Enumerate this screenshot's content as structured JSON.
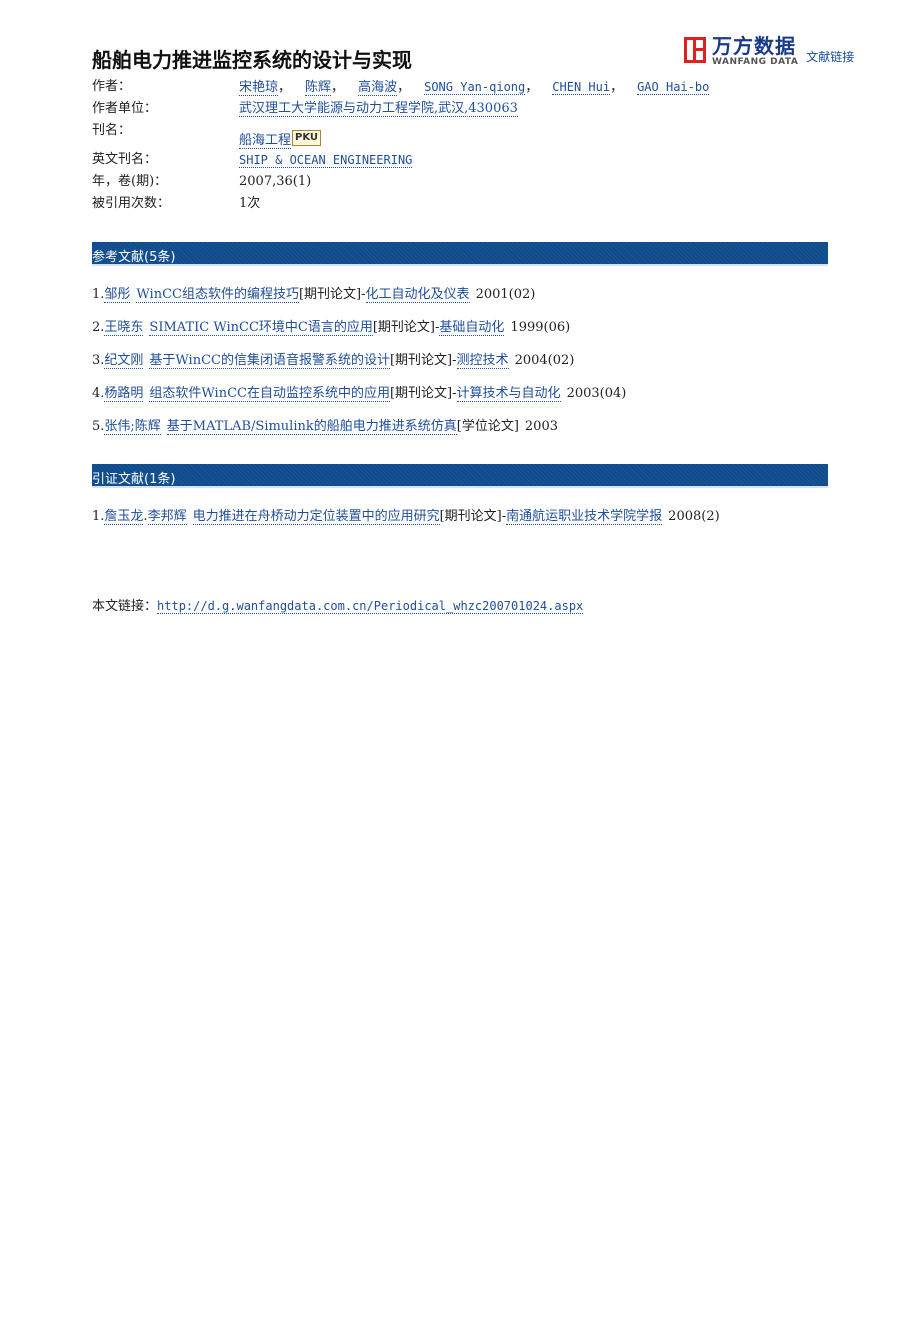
{
  "document": {
    "title": "船舶电力推进监控系统的设计与实现"
  },
  "logo": {
    "name_cn": "万方数据",
    "name_en": "WANFANG DATA",
    "link_label": "文献链接",
    "brand_color": "#e02020",
    "text_color": "#1a3a8a"
  },
  "meta": {
    "authors_label": "作者：",
    "authors": [
      {
        "name": "宋艳琼",
        "sep": "，"
      },
      {
        "name": "陈辉",
        "sep": "，"
      },
      {
        "name": "高海波",
        "sep": "，"
      },
      {
        "name": "SONG Yan-qiong",
        "sep": "，"
      },
      {
        "name": "CHEN Hui",
        "sep": "，"
      },
      {
        "name": "GAO Hai-bo",
        "sep": ""
      }
    ],
    "affiliation_label": "作者单位：",
    "affiliation": "武汉理工大学能源与动力工程学院,武汉,430063",
    "journal_label": "刊名：",
    "journal": "船海工程",
    "journal_badge": "PKU",
    "journal_en_label": "英文刊名：",
    "journal_en": "SHIP & OCEAN ENGINEERING",
    "year_vol_label": "年，卷(期)：",
    "year_vol": "2007,36(1)",
    "cited_label": "被引用次数：",
    "cited": "1次"
  },
  "references": {
    "header": "参考文献(5条)",
    "items": [
      {
        "num": "1.",
        "author": "邹彤",
        "title": "WinCC组态软件的编程技巧",
        "type": "[期刊论文]",
        "dash": "-",
        "source": "化工自动化及仪表",
        "date": "2001(02)"
      },
      {
        "num": "2.",
        "author": "王晓东",
        "title": "SIMATIC WinCC环境中C语言的应用",
        "type": "[期刊论文]",
        "dash": "-",
        "source": "基础自动化",
        "date": "1999(06)"
      },
      {
        "num": "3.",
        "author": "纪文刚",
        "title": "基于WinCC的信集闭语音报警系统的设计",
        "type": "[期刊论文]",
        "dash": "-",
        "source": "测控技术",
        "date": "2004(02)"
      },
      {
        "num": "4.",
        "author": "杨路明",
        "title": "组态软件WinCC在自动监控系统中的应用",
        "type": "[期刊论文]",
        "dash": "-",
        "source": "计算技术与自动化",
        "date": "2003(04)"
      },
      {
        "num": "5.",
        "author": "张伟;陈辉",
        "title": "基于MATLAB/Simulink的船舶电力推进系统仿真",
        "type": "[学位论文]",
        "dash": "",
        "source": "",
        "date": "2003"
      }
    ]
  },
  "citations": {
    "header": "引证文献(1条)",
    "items": [
      {
        "num": "1.",
        "author1": "詹玉龙",
        "author_sep": ".",
        "author2": "李邦辉",
        "title": "电力推进在舟桥动力定位装置中的应用研究",
        "type": "[期刊论文]",
        "dash": "-",
        "source": "南通航运职业技术学院学报",
        "date": "2008(2)"
      }
    ]
  },
  "footer": {
    "label": "本文链接：",
    "url": "http://d.g.wanfangdata.com.cn/Periodical_whzc200701024.aspx"
  },
  "colors": {
    "link": "#1f4e9a",
    "section_bar": "#0f4c8c"
  }
}
